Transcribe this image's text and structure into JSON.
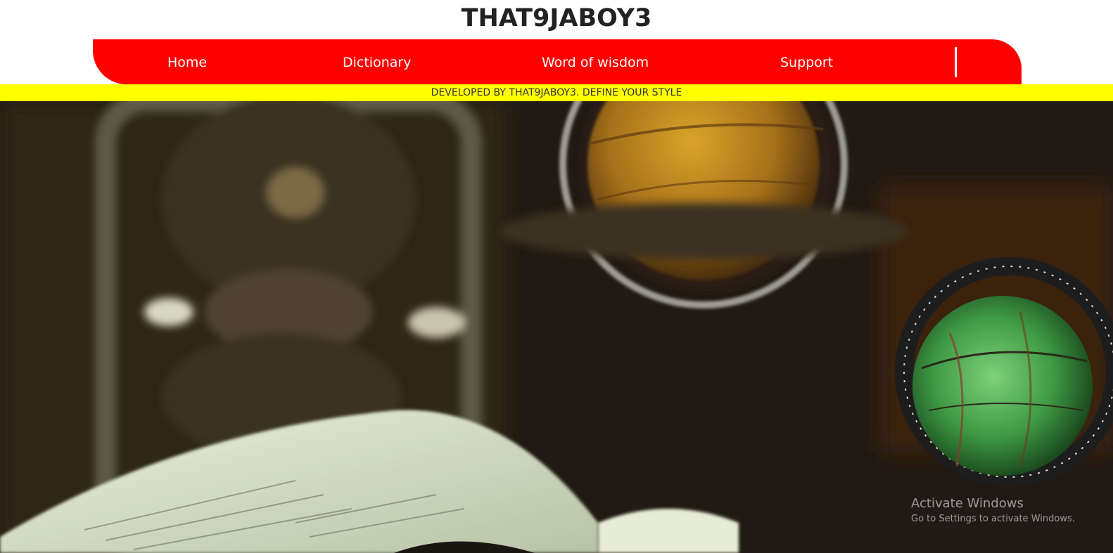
{
  "site": {
    "title": "THAT9JABOY3"
  },
  "nav": {
    "background_color": "#ff0000",
    "items": [
      {
        "label": "Home"
      },
      {
        "label": "Dictionary"
      },
      {
        "label": "Word of wisdom"
      },
      {
        "label": "Support"
      }
    ]
  },
  "banner": {
    "text": "DEVELOPED BY THAT9JABOY3. DEFINE YOUR STYLE",
    "background_color": "#ffff00"
  },
  "hero": {
    "image_description": "blurred photo of an hourglass, globes and an open book"
  },
  "watermark": {
    "title": "Activate Windows",
    "subtitle": "Go to Settings to activate Windows."
  }
}
